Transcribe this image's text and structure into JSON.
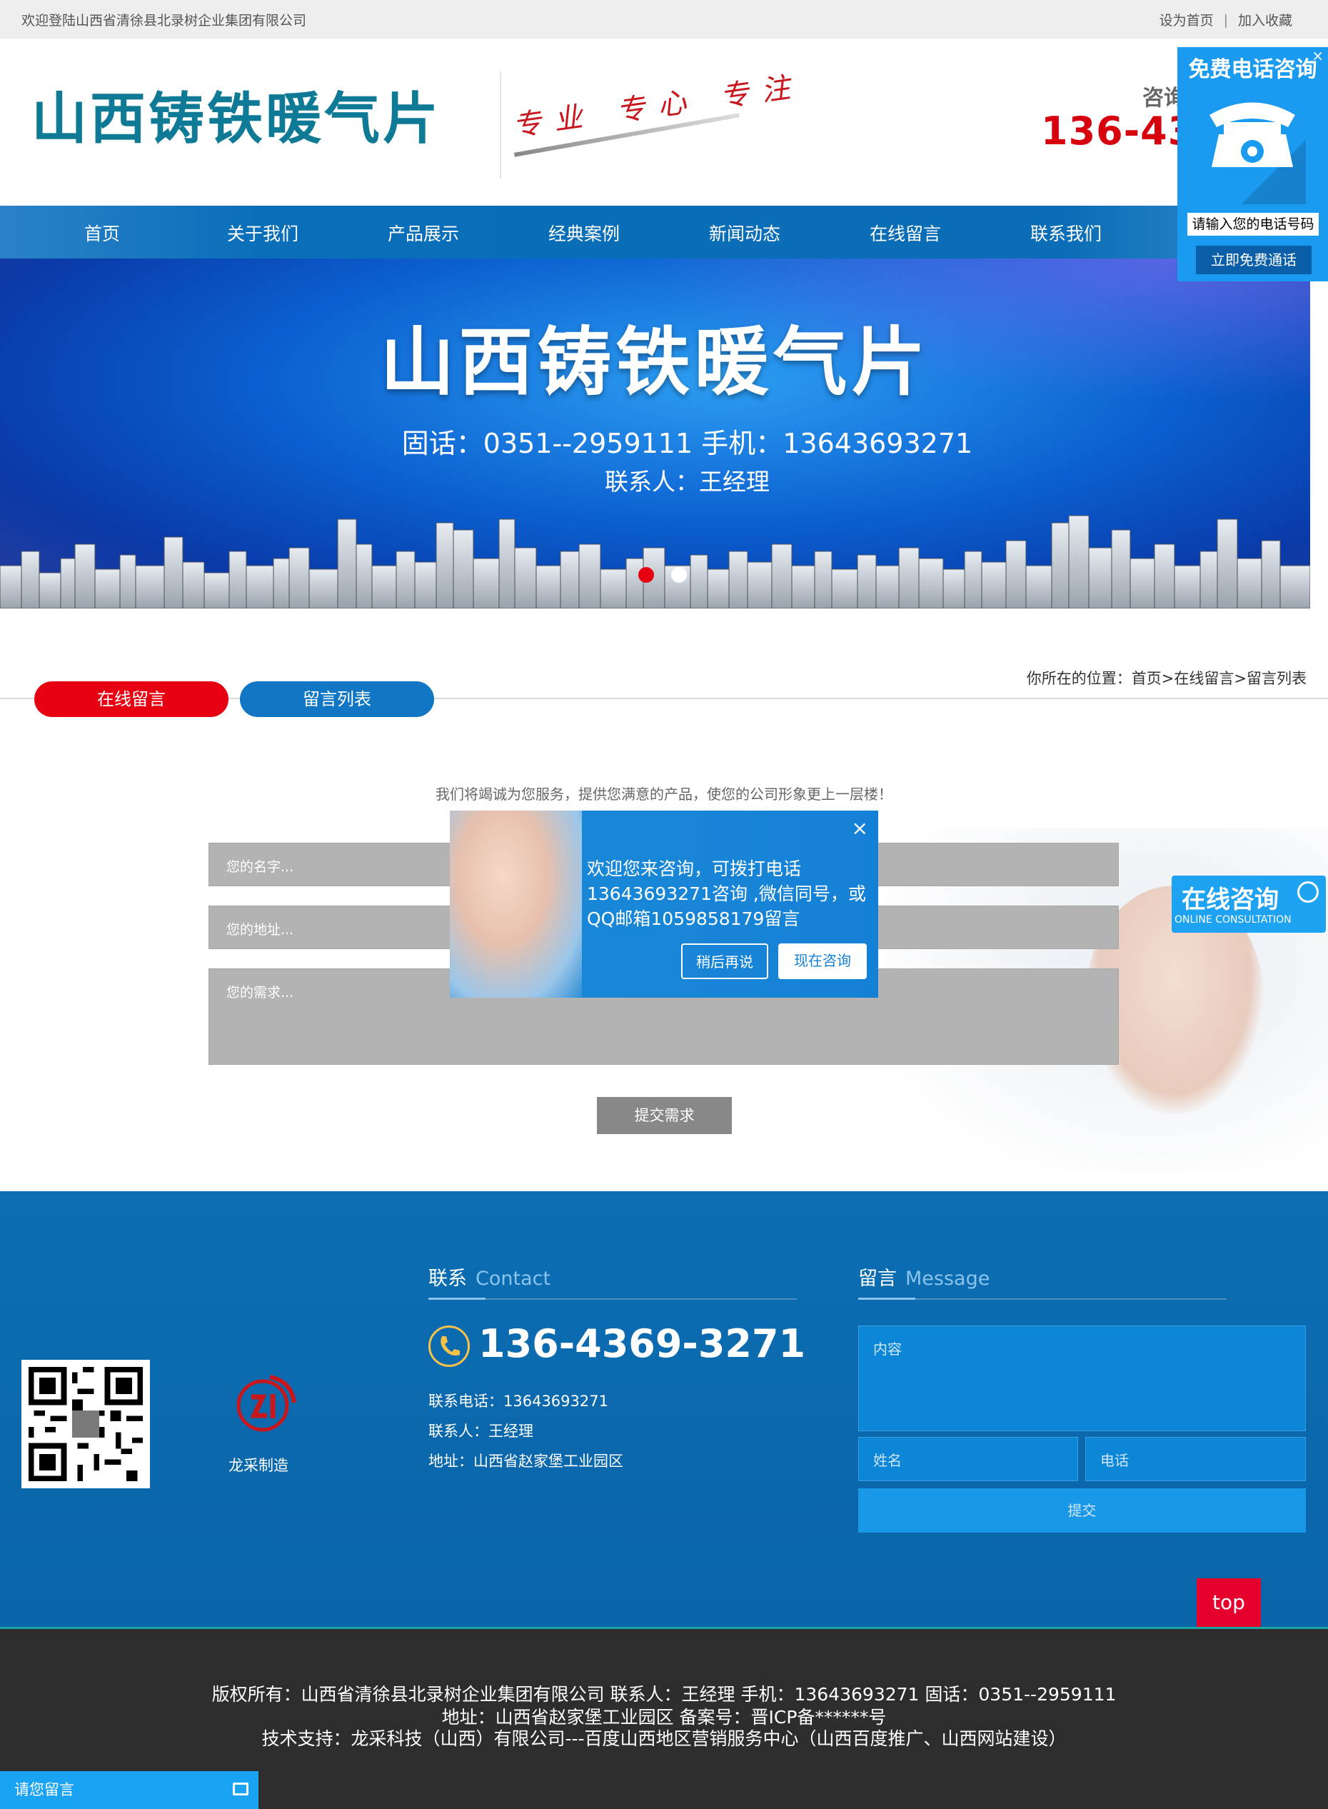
{
  "topbar": {
    "welcome": "欢迎登陆山西省清徐县北录树企业集团有限公司",
    "set_home": "设为首页",
    "separator": "|",
    "bookmark": "加入收藏"
  },
  "header": {
    "logo_title": "山西铸铁暖气片",
    "slogan": "专业 专心 专注",
    "consult_label": "咨询",
    "consult_phone": "136-4369"
  },
  "nav": {
    "items": [
      "首页",
      "关于我们",
      "产品展示",
      "经典案例",
      "新闻动态",
      "在线留言",
      "联系我们"
    ]
  },
  "banner": {
    "title": "山西铸铁暖气片",
    "phones": "固话：0351--2959111   手机：13643693271",
    "contact": "联系人：王经理",
    "active_slide": 1,
    "slide_count": 2,
    "colors": {
      "dot_active": "#e60012",
      "dot_inactive": "#ffffff"
    }
  },
  "breadcrumb": {
    "text": "你所在的位置：首页>在线留言>留言列表"
  },
  "tabs": {
    "online_message": "在线留言",
    "message_list": "留言列表"
  },
  "form": {
    "intro": "我们将竭诚为您服务，提供您满意的产品，使您的公司形象更上一层楼！",
    "name_placeholder": "您的名字...",
    "address_placeholder": "您的地址...",
    "need_placeholder": "您的需求...",
    "submit": "提交需求"
  },
  "popup": {
    "close": "×",
    "message": "欢迎您来咨询，可拨打电话13643693271咨询 ,微信同号，或QQ邮箱1059858179留言",
    "later": "稍后再说",
    "now": "现在咨询"
  },
  "call_widget": {
    "close": "×",
    "title": "免费电话咨询",
    "input_placeholder": "请输入您的电话号码",
    "button": "立即免费通话"
  },
  "online_widget": {
    "cn": "在线咨询",
    "en": "ONLINE CONSULTATION"
  },
  "footer": {
    "brand_name": "龙采制造",
    "contact_title": "联系",
    "contact_title_en": "Contact",
    "phone_big": "136-4369-3271",
    "phone_line": "联系电话：13643693271",
    "person_line": "联系人：王经理",
    "address_line": "地址：山西省赵家堡工业园区",
    "message_title": "留言",
    "message_title_en": "Message",
    "content_placeholder": "内容",
    "name_placeholder": "姓名",
    "tel_placeholder": "电话",
    "submit": "提交",
    "top": "top"
  },
  "copyright": {
    "line1": "版权所有：山西省清徐县北录树企业集团有限公司 联系人：王经理   手机：13643693271   固话：0351--2959111",
    "line2": "地址：山西省赵家堡工业园区 备案号：晋ICP备******号",
    "line3": "技术支持：龙采科技（山西）有限公司---百度山西地区营销服务中心（山西百度推广、山西网站建设）"
  },
  "leave_message": {
    "label": "请您留言"
  }
}
